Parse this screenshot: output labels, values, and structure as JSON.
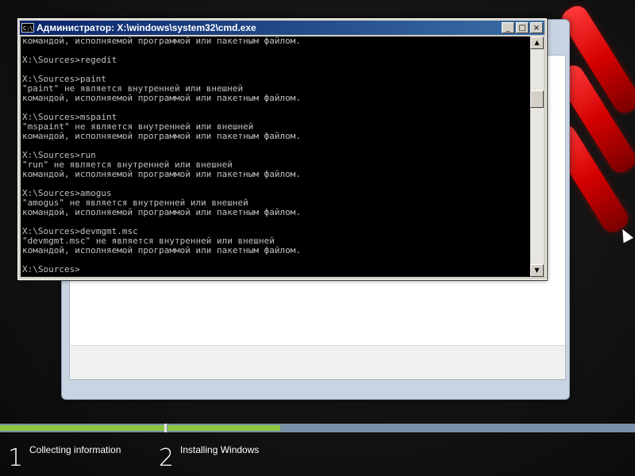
{
  "console": {
    "title": "Администратор: X:\\windows\\system32\\cmd.exe",
    "icon": "cmd-icon",
    "lines": [
      "командой, исполняемой программой или пакетным файлом.",
      "",
      "X:\\Sources>regedit",
      "",
      "X:\\Sources>paint",
      "\"paint\" не является внутренней или внешней",
      "командой, исполняемой программой или пакетным файлом.",
      "",
      "X:\\Sources>mspaint",
      "\"mspaint\" не является внутренней или внешней",
      "командой, исполняемой программой или пакетным файлом.",
      "",
      "X:\\Sources>run",
      "\"run\" не является внутренней или внешней",
      "командой, исполняемой программой или пакетным файлом.",
      "",
      "X:\\Sources>amogus",
      "\"amogus\" не является внутренней или внешней",
      "командой, исполняемой программой или пакетным файлом.",
      "",
      "X:\\Sources>devmgmt.msc",
      "\"devmgmt.msc\" не является внутренней или внешней",
      "командой, исполняемой программой или пакетным файлом.",
      "",
      "X:\\Sources>"
    ],
    "buttons": {
      "minimize": "_",
      "maximize": "□",
      "close": "×"
    }
  },
  "setup": {
    "steps": [
      {
        "number": "1",
        "label": "Collecting information"
      },
      {
        "number": "2",
        "label": "Installing Windows"
      }
    ],
    "progress": {
      "step1": 1.0,
      "step2": 0.32
    }
  },
  "colors": {
    "accent_progress": "#8cc63f",
    "stripe_red": "#d40000",
    "console_bg": "#000000",
    "console_fg": "#c0c0c0"
  }
}
